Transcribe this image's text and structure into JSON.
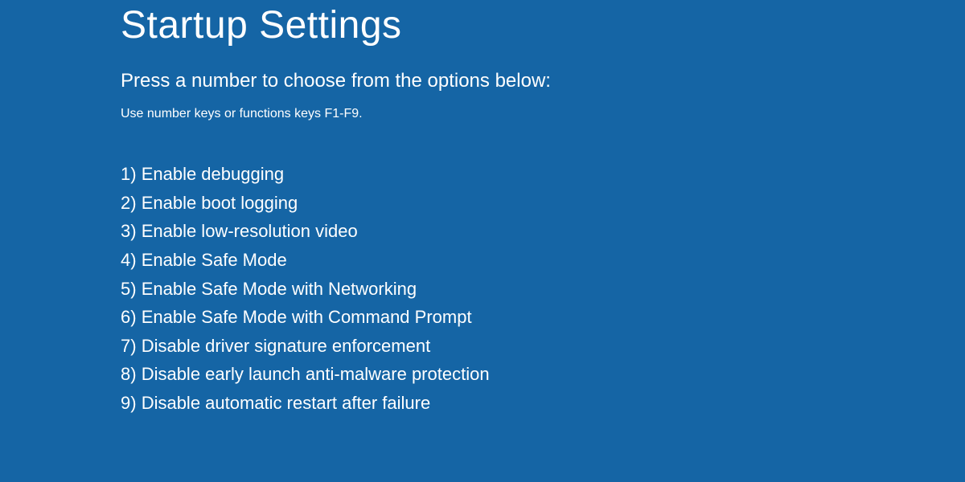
{
  "title": "Startup Settings",
  "instruction": "Press a number to choose from the options below:",
  "hint": "Use number keys or functions keys F1-F9.",
  "options": [
    {
      "num": "1)",
      "label": "Enable debugging"
    },
    {
      "num": "2)",
      "label": "Enable boot logging"
    },
    {
      "num": "3)",
      "label": "Enable low-resolution video"
    },
    {
      "num": "4)",
      "label": "Enable Safe Mode"
    },
    {
      "num": "5)",
      "label": "Enable Safe Mode with Networking"
    },
    {
      "num": "6)",
      "label": "Enable Safe Mode with Command Prompt"
    },
    {
      "num": "7)",
      "label": "Disable driver signature enforcement"
    },
    {
      "num": "8)",
      "label": "Disable early launch anti-malware protection"
    },
    {
      "num": "9)",
      "label": "Disable automatic restart after failure"
    }
  ]
}
